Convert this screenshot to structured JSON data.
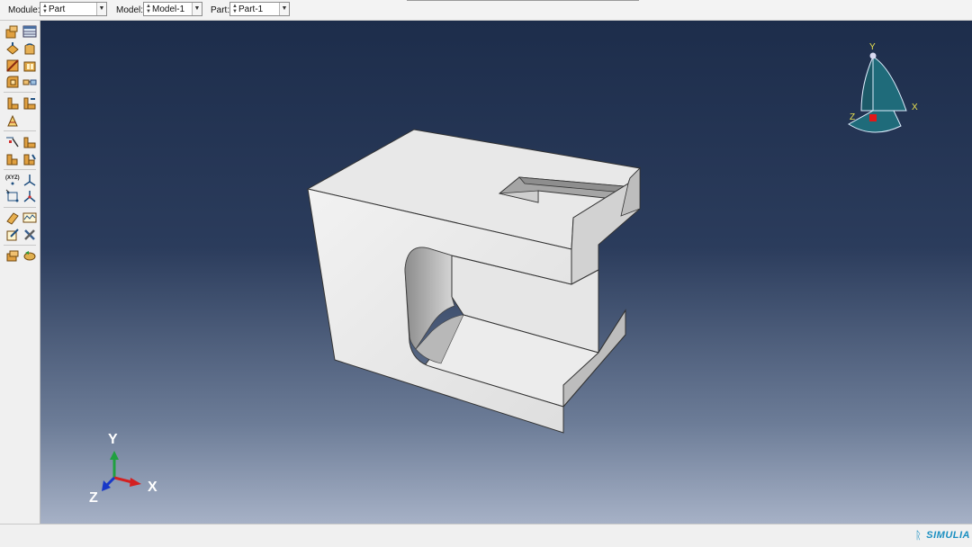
{
  "context_bar": {
    "module_label": "Module:",
    "module_value": "Part",
    "model_label": "Model:",
    "model_value": "Model-1",
    "part_label": "Part:",
    "part_value": "Part-1"
  },
  "toolbox": {
    "tools": [
      "create-part-icon",
      "part-manager-icon",
      "create-solid-extrude-icon",
      "create-solid-revolve-icon",
      "create-cut-icon",
      "create-shell-icon",
      "create-fillet-icon",
      "create-chamfer-icon",
      "partition-face-icon",
      "partition-cell-icon",
      "create-wire-icon",
      "datum-point-icon",
      "datum-axis-icon",
      "datum-plane-icon",
      "datum-csys-icon",
      "xyz-point-icon",
      "datum-axes-icon",
      "mesh-seed-icon",
      "geometry-edit-icon",
      "query-icon",
      "plot-icon",
      "repair-icon",
      "tools-icon",
      "attributes-icon",
      "undo-icon"
    ]
  },
  "viewport": {
    "triad": {
      "x_label": "X",
      "y_label": "Y",
      "z_label": "Z"
    },
    "view_cube": {
      "x_label": "X",
      "y_label": "Y",
      "z_label": "Z"
    }
  },
  "status": {
    "brand": "SIMULIA"
  },
  "colors": {
    "triad_x": "#d42020",
    "triad_y": "#20a040",
    "triad_z": "#1838c8",
    "cube_fill": "#1f6b7a",
    "cube_label": "#e8e050"
  }
}
